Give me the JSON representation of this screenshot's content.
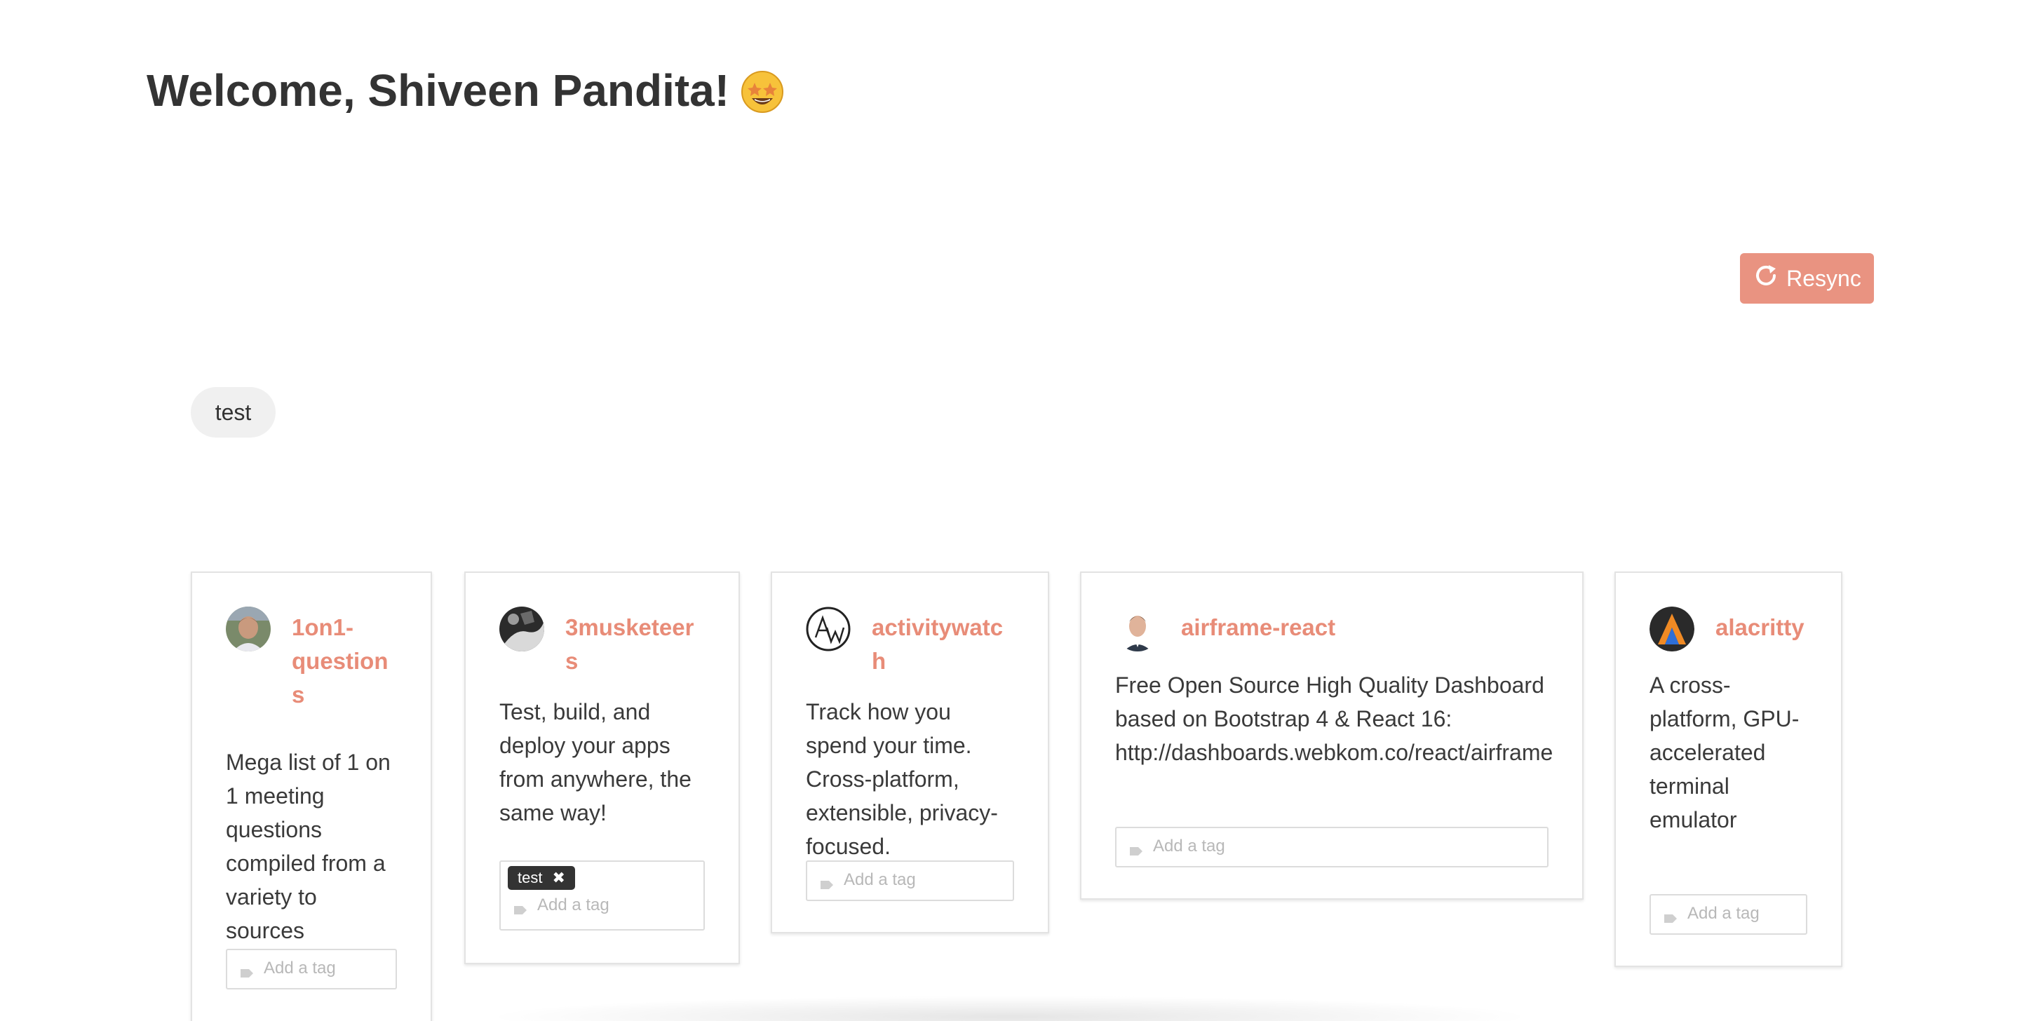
{
  "header": {
    "welcome_text": "Welcome, Shiveen Pandita!",
    "emoji": "star-struck-emoji"
  },
  "toolbar": {
    "resync_label": "Resync",
    "resync_icon": "refresh-icon",
    "accent_color": "#e99381"
  },
  "filters": {
    "tags": [
      "test"
    ]
  },
  "repos": [
    {
      "name": "1on1-questions",
      "description": "Mega list of 1 on 1 meeting questions compiled from a variety to sources",
      "tags": [],
      "tag_placeholder": "Add a tag"
    },
    {
      "name": "3musketeers",
      "description": "Test, build, and deploy your apps from anywhere, the same way!",
      "tags": [
        "test"
      ],
      "tag_placeholder": "Add a tag"
    },
    {
      "name": "activitywatch",
      "description": "Track how you spend your time. Cross-platform, extensible, privacy-focused.",
      "tags": [],
      "tag_placeholder": "Add a tag"
    },
    {
      "name": "airframe-react",
      "description": "Free Open Source High Quality Dashboard based on Bootstrap 4 & React 16: http://dashboards.webkom.co/react/airframe",
      "tags": [],
      "tag_placeholder": "Add a tag"
    },
    {
      "name": "alacritty",
      "description": "A cross-platform, GPU-accelerated terminal emulator",
      "tags": [],
      "tag_placeholder": "Add a tag"
    }
  ]
}
